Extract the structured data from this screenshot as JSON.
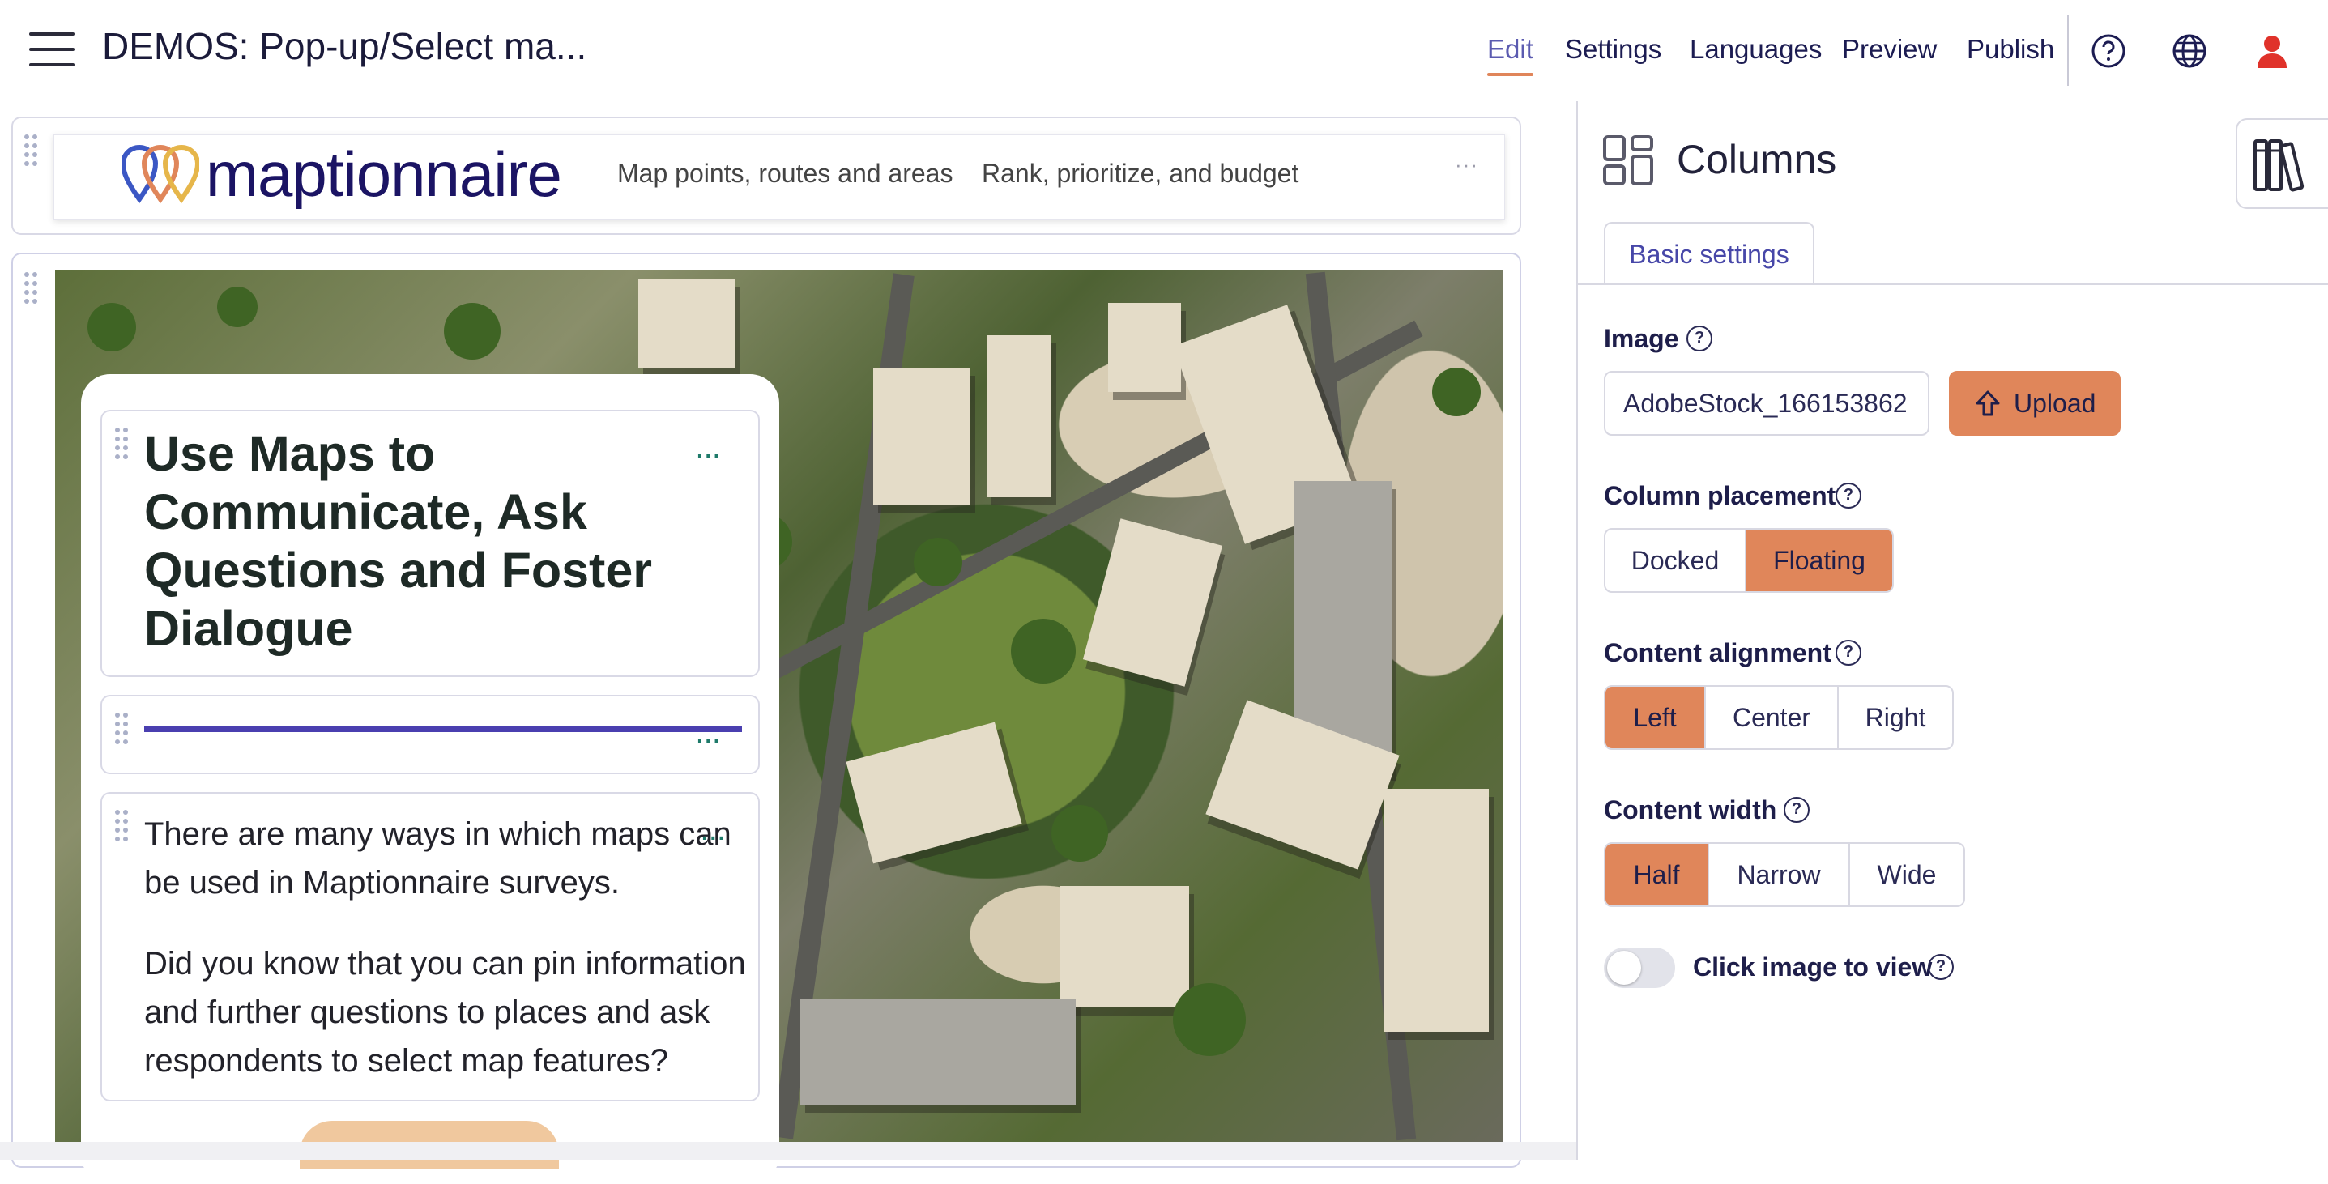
{
  "topbar": {
    "title": "DEMOS: Pop-up/Select ma...",
    "nav": [
      "Edit",
      "Settings",
      "Languages",
      "Preview",
      "Publish"
    ],
    "active_nav": "Edit",
    "icons": [
      "help-icon",
      "globe-icon",
      "user-icon"
    ]
  },
  "header_block": {
    "logo_text": "maptionnaire",
    "links": [
      "Map points, routes and areas",
      "Rank, prioritize, and budget"
    ],
    "more": "···"
  },
  "content_block": {
    "heading": "Use Maps to Communicate, Ask Questions and Foster Dialogue",
    "paragraph1": "There are many ways in which maps can be used in Maptionnaire surveys.",
    "paragraph2": "Did you know that you can pin information and further questions to places and ask respondents to select map features?",
    "more": "···"
  },
  "panel": {
    "title": "Columns",
    "tab": "Basic settings",
    "image_label": "Image",
    "image_value": "AdobeStock_166153862",
    "upload_label": "Upload",
    "placement_label": "Column placement",
    "placement_options": [
      "Docked",
      "Floating"
    ],
    "placement_selected": "Floating",
    "alignment_label": "Content alignment",
    "alignment_options": [
      "Left",
      "Center",
      "Right"
    ],
    "alignment_selected": "Left",
    "width_label": "Content width",
    "width_options": [
      "Half",
      "Narrow",
      "Wide"
    ],
    "width_selected": "Half",
    "click_image_label": "Click image to view",
    "click_image_enabled": false,
    "help_glyph": "?"
  },
  "colors": {
    "accent_orange": "#e0865a",
    "brand_navy": "#1b1464",
    "rule_purple": "#4a3fb0",
    "active_nav": "#5b5bb0"
  }
}
